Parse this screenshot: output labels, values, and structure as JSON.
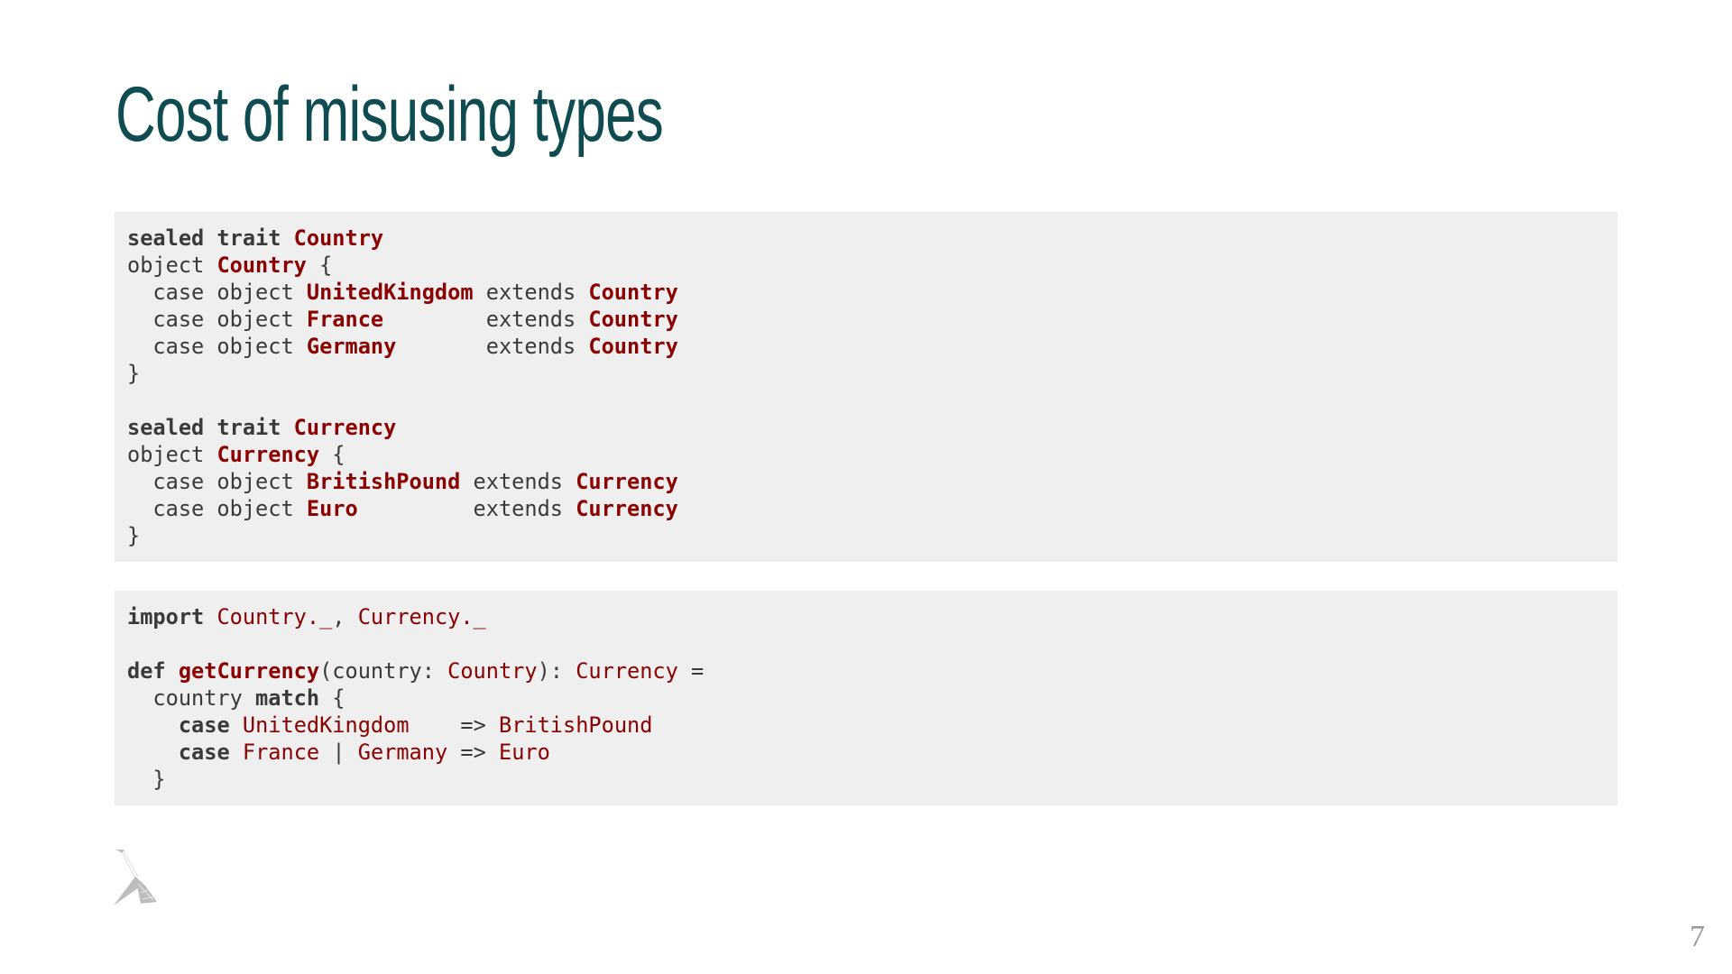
{
  "slide": {
    "title": "Cost of misusing types",
    "page_number": "7",
    "logo": "lambda-logo",
    "colors": {
      "title": "#0f4c52",
      "code_bg": "#efefef",
      "type_name": "#8b0000",
      "text": "#3a3a3a"
    }
  },
  "code_blocks": [
    {
      "lines": [
        [
          [
            "kw",
            "sealed trait "
          ],
          [
            "tb",
            "Country"
          ]
        ],
        [
          [
            "n",
            "object "
          ],
          [
            "tb",
            "Country"
          ],
          [
            "n",
            " {"
          ]
        ],
        [
          [
            "n",
            "  case object "
          ],
          [
            "tb",
            "UnitedKingdom"
          ],
          [
            "n",
            " extends "
          ],
          [
            "tb",
            "Country"
          ]
        ],
        [
          [
            "n",
            "  case object "
          ],
          [
            "tb",
            "France"
          ],
          [
            "n",
            "        extends "
          ],
          [
            "tb",
            "Country"
          ]
        ],
        [
          [
            "n",
            "  case object "
          ],
          [
            "tb",
            "Germany"
          ],
          [
            "n",
            "       extends "
          ],
          [
            "tb",
            "Country"
          ]
        ],
        [
          [
            "n",
            "}"
          ]
        ],
        [],
        [
          [
            "kw",
            "sealed trait "
          ],
          [
            "tb",
            "Currency"
          ]
        ],
        [
          [
            "n",
            "object "
          ],
          [
            "tb",
            "Currency"
          ],
          [
            "n",
            " {"
          ]
        ],
        [
          [
            "n",
            "  case object "
          ],
          [
            "tb",
            "BritishPound"
          ],
          [
            "n",
            " extends "
          ],
          [
            "tb",
            "Currency"
          ]
        ],
        [
          [
            "n",
            "  case object "
          ],
          [
            "tb",
            "Euro"
          ],
          [
            "n",
            "         extends "
          ],
          [
            "tb",
            "Currency"
          ]
        ],
        [
          [
            "n",
            "}"
          ]
        ]
      ]
    },
    {
      "lines": [
        [
          [
            "kw",
            "import"
          ],
          [
            "n",
            " "
          ],
          [
            "t",
            "Country._"
          ],
          [
            "n",
            ", "
          ],
          [
            "t",
            "Currency._"
          ]
        ],
        [],
        [
          [
            "kw",
            "def "
          ],
          [
            "tb",
            "getCurrency"
          ],
          [
            "n",
            "(country: "
          ],
          [
            "t",
            "Country"
          ],
          [
            "n",
            "): "
          ],
          [
            "t",
            "Currency"
          ],
          [
            "n",
            " ="
          ]
        ],
        [
          [
            "n",
            "  country "
          ],
          [
            "kw",
            "match"
          ],
          [
            "n",
            " {"
          ]
        ],
        [
          [
            "n",
            "    "
          ],
          [
            "kw",
            "case"
          ],
          [
            "n",
            " "
          ],
          [
            "t",
            "UnitedKingdom"
          ],
          [
            "n",
            "    => "
          ],
          [
            "t",
            "BritishPound"
          ]
        ],
        [
          [
            "n",
            "    "
          ],
          [
            "kw",
            "case"
          ],
          [
            "n",
            " "
          ],
          [
            "t",
            "France"
          ],
          [
            "n",
            " | "
          ],
          [
            "t",
            "Germany"
          ],
          [
            "n",
            " => "
          ],
          [
            "t",
            "Euro"
          ]
        ],
        [
          [
            "n",
            "  }"
          ]
        ]
      ]
    }
  ]
}
